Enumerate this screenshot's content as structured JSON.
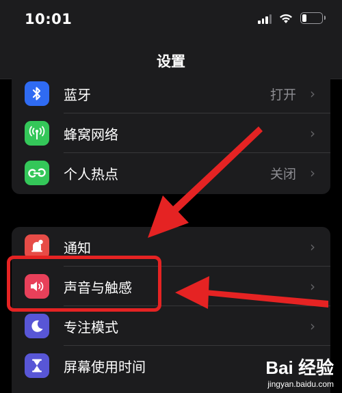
{
  "status_bar": {
    "time": "10:01"
  },
  "nav": {
    "title": "设置"
  },
  "group1": [
    {
      "label": "蓝牙",
      "value": "打开",
      "icon": "bluetooth-icon",
      "color": "#2f6bf2"
    },
    {
      "label": "蜂窝网络",
      "value": "",
      "icon": "antenna-icon",
      "color": "#34c759"
    },
    {
      "label": "个人热点",
      "value": "关闭",
      "icon": "hotspot-icon",
      "color": "#34c759"
    }
  ],
  "group2": [
    {
      "label": "通知",
      "value": "",
      "icon": "notification-icon",
      "color": "#e64c47"
    },
    {
      "label": "声音与触感",
      "value": "",
      "icon": "speaker-icon",
      "color": "#e8405a"
    },
    {
      "label": "专注模式",
      "value": "",
      "icon": "moon-icon",
      "color": "#5856d6"
    },
    {
      "label": "屏幕使用时间",
      "value": "",
      "icon": "hourglass-icon",
      "color": "#5856d6"
    }
  ],
  "chevron": "›",
  "watermark": {
    "logo": "Bai 经验",
    "sub": "jingyan.baidu.com"
  },
  "colors": {
    "highlight": "#e52323",
    "arrow": "#e52323"
  }
}
